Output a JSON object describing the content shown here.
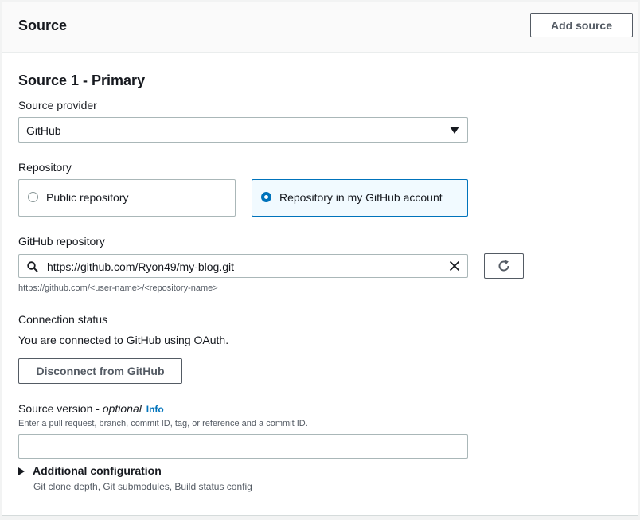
{
  "header": {
    "title": "Source",
    "add_source_label": "Add source"
  },
  "source": {
    "section_title": "Source 1 - Primary",
    "provider": {
      "label": "Source provider",
      "value": "GitHub"
    },
    "repository": {
      "label": "Repository",
      "options": [
        {
          "label": "Public repository",
          "selected": false
        },
        {
          "label": "Repository in my GitHub account",
          "selected": true
        }
      ]
    },
    "github_repo": {
      "label": "GitHub repository",
      "value": "https://github.com/Ryon49/my-blog.git",
      "hint": "https://github.com/<user-name>/<repository-name>"
    },
    "connection": {
      "label": "Connection status",
      "status_text": "You are connected to GitHub using OAuth.",
      "disconnect_label": "Disconnect from GitHub"
    },
    "version": {
      "label": "Source version -",
      "optional": "optional",
      "info": "Info",
      "description": "Enter a pull request, branch, commit ID, tag, or reference and a commit ID.",
      "value": ""
    },
    "additional": {
      "label": "Additional configuration",
      "description": "Git clone depth, Git submodules, Build status config"
    }
  },
  "colors": {
    "accent": "#0073bb",
    "border": "#aab7b8",
    "text": "#16191f",
    "muted": "#545b64"
  }
}
